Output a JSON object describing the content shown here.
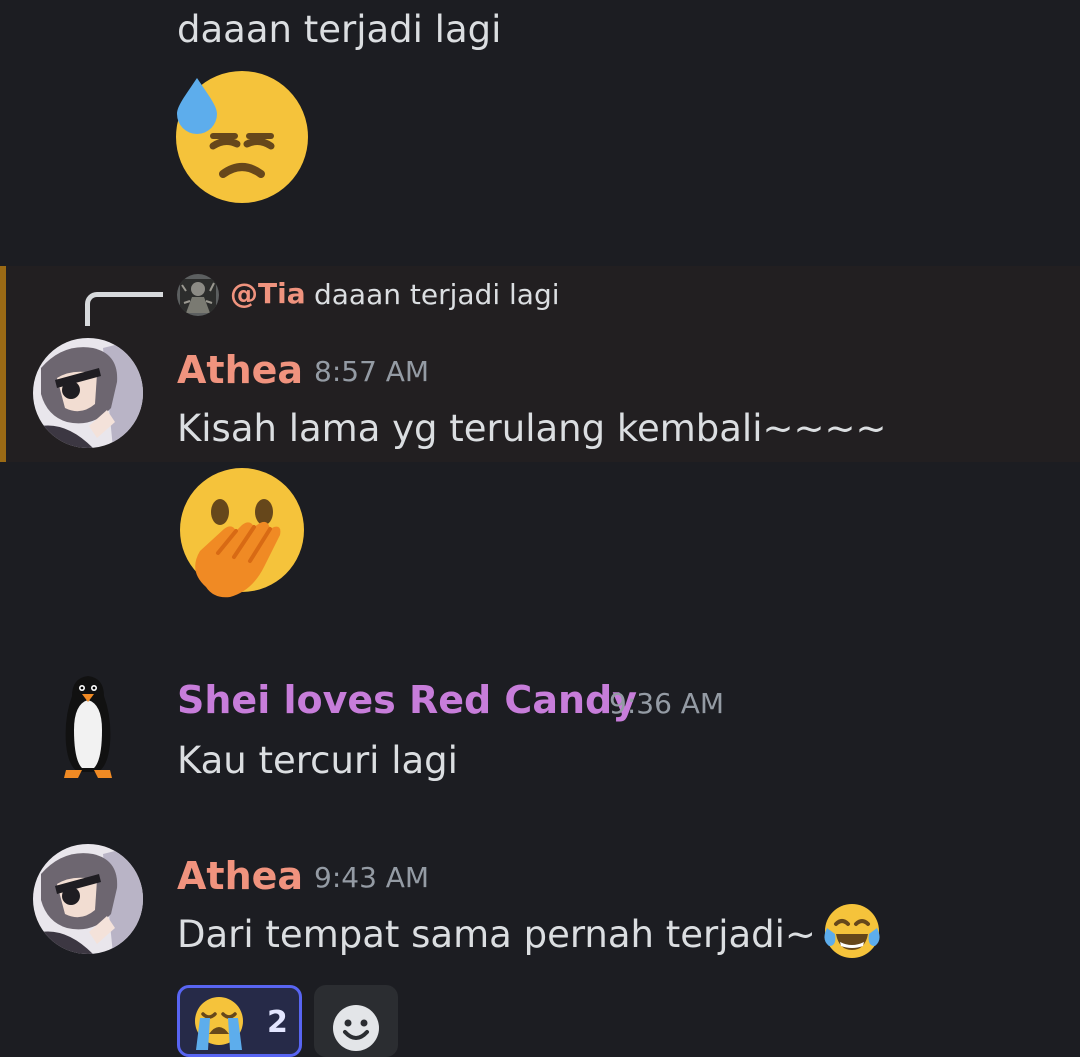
{
  "colors": {
    "background": "#1c1d22",
    "highlight_background": "#221f21",
    "highlight_bar": "#9a6a15",
    "athea_name": "#f0937e",
    "shei_name": "#c77dda",
    "tia_mention": "#f0937e",
    "message_text": "#dbdee1",
    "timestamp_text": "#949ba4",
    "reaction_border": "#5865f2"
  },
  "messages": [
    {
      "text": "daaan terjadi lagi",
      "emoji": "downcast-face-with-sweat-icon"
    },
    {
      "reply": {
        "mention": "@Tia",
        "text": "daaan terjadi lagi",
        "avatar_icon": "tia-avatar-icon"
      },
      "author": "Athea",
      "time": "8:57 AM",
      "avatar_icon": "athea-avatar-icon",
      "text": "Kisah lama yg terulang kembali~~~~",
      "emoji": "face-with-hand-over-mouth-icon"
    },
    {
      "author": "Shei loves Red Candy",
      "time": "9:36 AM",
      "avatar_icon": "penguin-avatar-icon",
      "text": "Kau tercuri lagi"
    },
    {
      "author": "Athea",
      "time": "9:43 AM",
      "avatar_icon": "athea-avatar-icon",
      "text": "Dari tempat sama pernah terjadi~",
      "inline_emoji": "face-with-tears-of-joy-icon",
      "reactions": [
        {
          "emoji": "loudly-crying-face-icon",
          "count": "2",
          "selected": true
        }
      ],
      "add_reaction_icon": "add-reaction-smiley-icon"
    }
  ]
}
